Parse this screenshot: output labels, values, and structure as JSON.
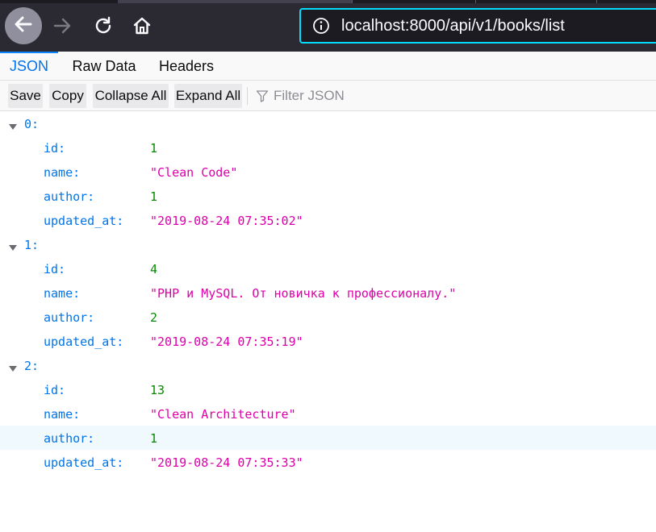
{
  "browser": {
    "url": "localhost:8000/api/v1/books/list"
  },
  "viewer": {
    "tabs": [
      "JSON",
      "Raw Data",
      "Headers"
    ],
    "active_tab": "JSON"
  },
  "toolbar": {
    "save_label": "Save",
    "copy_label": "Copy",
    "collapse_label": "Collapse All",
    "expand_label": "Expand All",
    "filter_placeholder": "Filter JSON"
  },
  "colors": {
    "key": "#0074e8",
    "number": "#058b00",
    "string": "#dd00a9",
    "accent": "#0a84ff"
  },
  "json": {
    "items": [
      {
        "label": "0:",
        "fields": [
          {
            "key": "id:",
            "value": "1",
            "type": "number"
          },
          {
            "key": "name:",
            "value": "\"Clean Code\"",
            "type": "string"
          },
          {
            "key": "author:",
            "value": "1",
            "type": "number"
          },
          {
            "key": "updated_at:",
            "value": "\"2019-08-24 07:35:02\"",
            "type": "string"
          }
        ]
      },
      {
        "label": "1:",
        "fields": [
          {
            "key": "id:",
            "value": "4",
            "type": "number"
          },
          {
            "key": "name:",
            "value": "\"PHP и MySQL. От новичка к профессионалу.\"",
            "type": "string"
          },
          {
            "key": "author:",
            "value": "2",
            "type": "number"
          },
          {
            "key": "updated_at:",
            "value": "\"2019-08-24 07:35:19\"",
            "type": "string"
          }
        ]
      },
      {
        "label": "2:",
        "fields": [
          {
            "key": "id:",
            "value": "13",
            "type": "number"
          },
          {
            "key": "name:",
            "value": "\"Clean Architecture\"",
            "type": "string"
          },
          {
            "key": "author:",
            "value": "1",
            "type": "number",
            "hovered": true
          },
          {
            "key": "updated_at:",
            "value": "\"2019-08-24 07:35:33\"",
            "type": "string"
          }
        ]
      }
    ]
  }
}
